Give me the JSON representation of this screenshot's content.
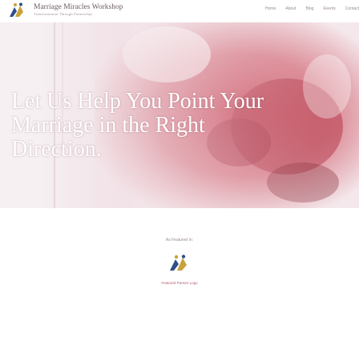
{
  "header": {
    "brand_name": "Marriage Miracles Workshop",
    "brand_tagline": "Transformation Through Partnership",
    "nav": [
      "Home",
      "About",
      "Blog",
      "Events",
      "Contact"
    ]
  },
  "hero": {
    "lines": [
      "Let Us Help You Point Your",
      "Marriage in the Right",
      "Direction."
    ]
  },
  "featured": {
    "label": "As Featured In:",
    "caption": "Featured Partner Logo"
  },
  "colors": {
    "brand_text": "#6a5a63",
    "logo_gold": "#c8a23a",
    "logo_blue": "#2f4f8a",
    "hero_rose": "#c94a5c"
  }
}
